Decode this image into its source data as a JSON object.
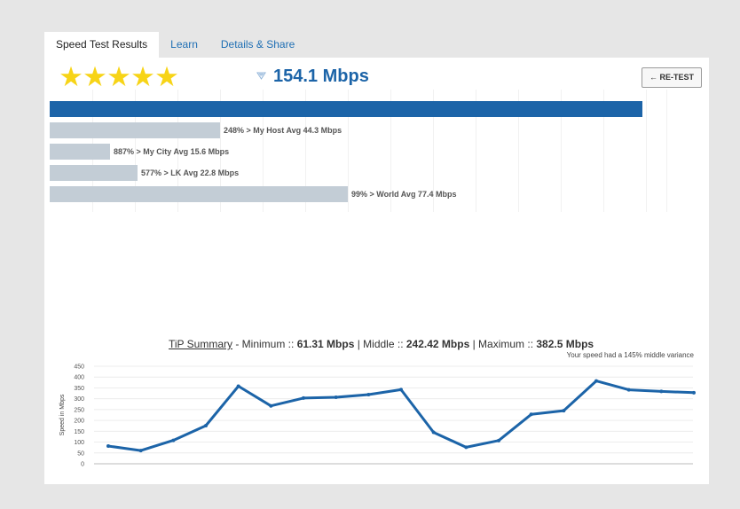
{
  "tabs": [
    {
      "label": "Speed Test Results"
    },
    {
      "label": "Learn"
    },
    {
      "label": "Details & Share"
    }
  ],
  "rating": {
    "stars": 5,
    "max": 5,
    "glyph": "★"
  },
  "speed": {
    "icon": "download-icon",
    "value": "154.1 Mbps"
  },
  "retest_label": "← RE-TEST",
  "comparison": {
    "scale_max_mbps": 156.5,
    "main_value": 154.1,
    "items": [
      {
        "value": 44.3,
        "label": "248% > My Host Avg 44.3 Mbps"
      },
      {
        "value": 15.6,
        "label": "887% > My City Avg 15.6 Mbps"
      },
      {
        "value": 22.8,
        "label": "577% > LK Avg 22.8 Mbps"
      },
      {
        "value": 77.4,
        "label": "99% > World Avg 77.4 Mbps"
      }
    ]
  },
  "summary": {
    "title": "TiP Summary",
    "min_label": " - Minimum :: ",
    "min_value": "61.31 Mbps",
    "mid_label": " | Middle :: ",
    "mid_value": "242.42 Mbps",
    "max_label": " | Maximum :: ",
    "max_value": "382.5 Mbps",
    "variance": "Your speed had a 145% middle variance"
  },
  "chart_data": {
    "type": "line",
    "ylabel": "Speed in Mbps",
    "ylim": [
      0,
      450
    ],
    "yticks": [
      0,
      50,
      100,
      150,
      200,
      250,
      300,
      350,
      400,
      450
    ],
    "grid": true,
    "color": "#1c64a8",
    "series": [
      {
        "values": [
          82,
          61,
          108,
          176,
          358,
          267,
          303,
          307,
          319,
          342,
          145,
          76,
          107,
          228,
          245,
          382,
          341,
          334,
          328
        ]
      }
    ]
  }
}
